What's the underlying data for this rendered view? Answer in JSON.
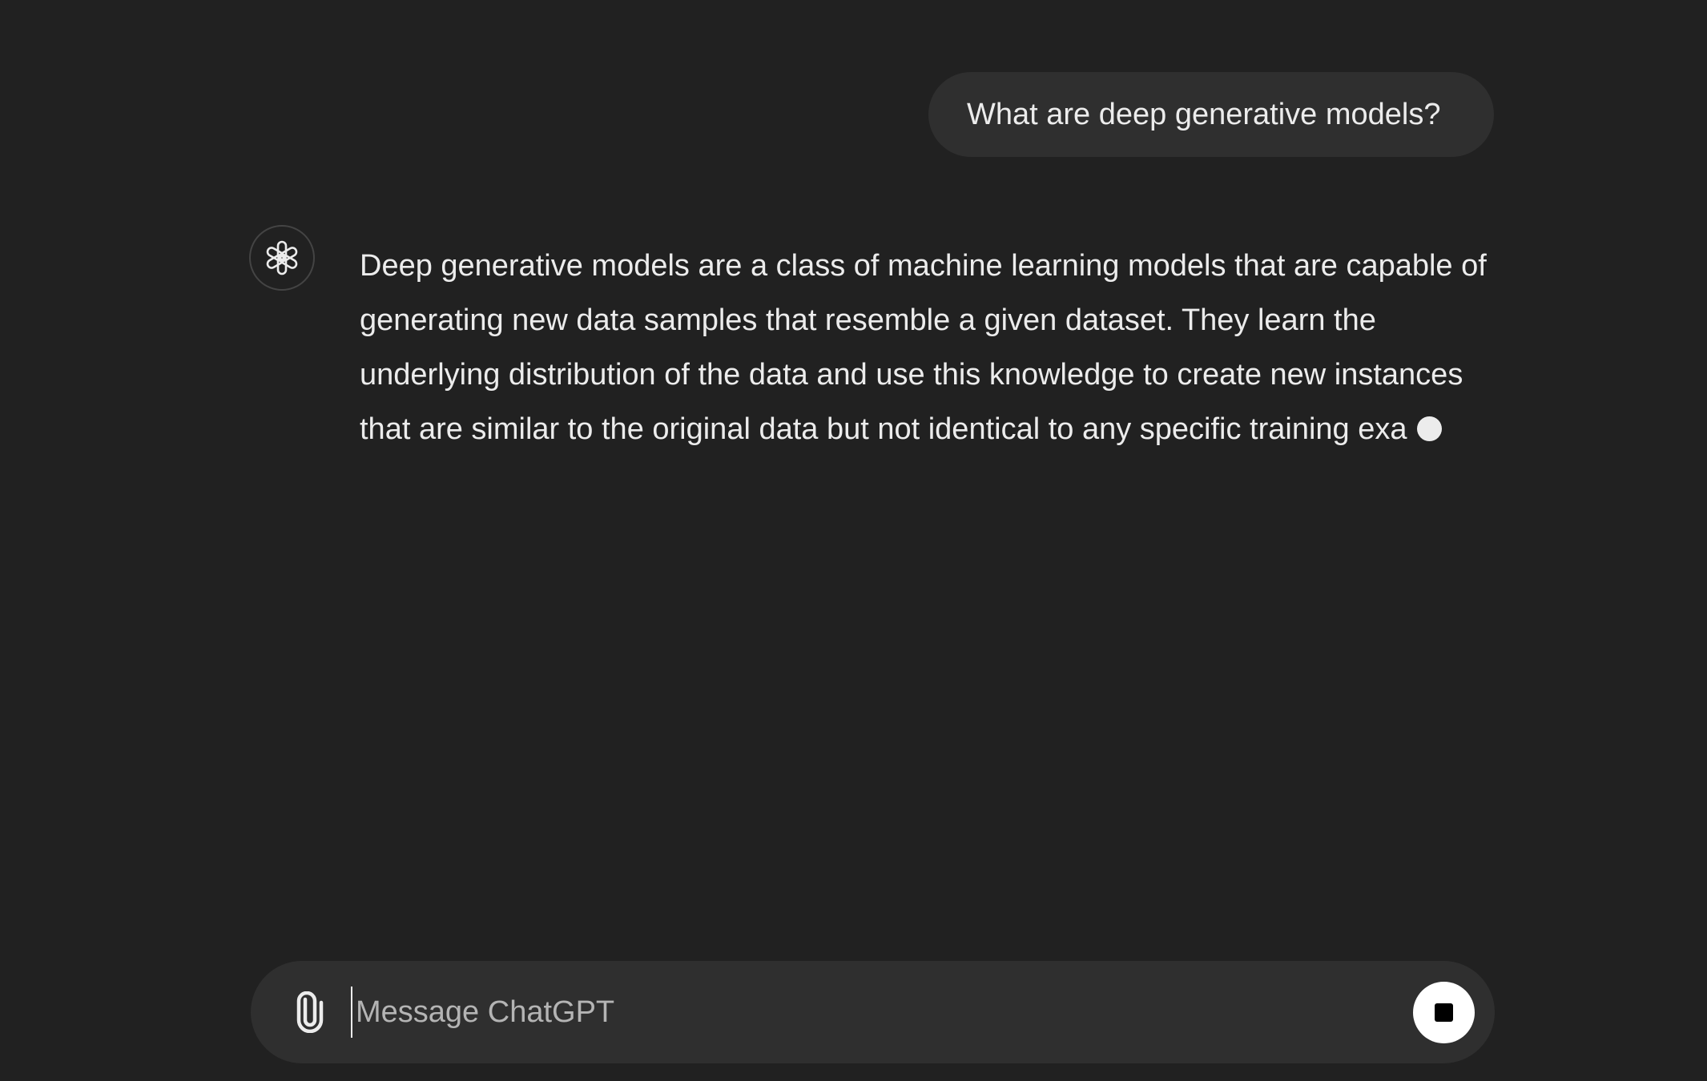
{
  "conversation": {
    "user_message": "What are deep generative models?",
    "assistant_avatar_icon": "openai-logo-icon",
    "assistant_message": "Deep generative models are a class of machine learning models that are capable of generating new data samples that resemble a given dataset. They learn the underlying distribution of the data and use this knowledge to create new instances that are similar to the original data but not identical to any specific training exa"
  },
  "composer": {
    "attach_icon": "paperclip-icon",
    "placeholder": "Message ChatGPT",
    "value": "",
    "stop_icon": "stop-icon"
  },
  "colors": {
    "background": "#212121",
    "bubble": "#2f2f2f",
    "text": "#ececec",
    "placeholder": "#b4b4b4",
    "stop_button": "#ffffff"
  }
}
